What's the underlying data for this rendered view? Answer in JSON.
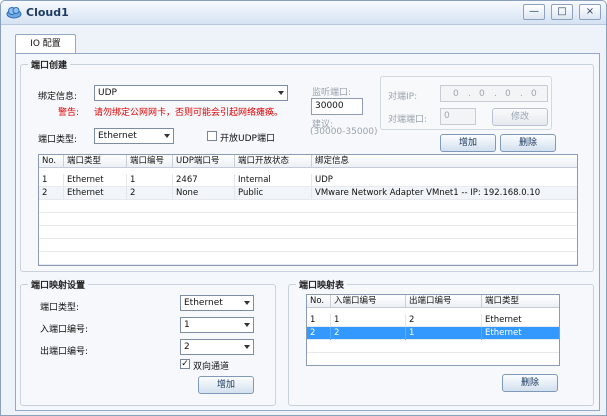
{
  "window": {
    "title": "Cloud1",
    "controls": {
      "minimize": "—",
      "maximize": "□",
      "close": "×"
    }
  },
  "tab": {
    "label": "IO 配置"
  },
  "port_create": {
    "title": "端口创建",
    "bind_label": "绑定信息:",
    "bind_value": "UDP",
    "warning_label": "警告:",
    "warning_text": "请勿绑定公网网卡，否则可能会引起网络瘫痪。",
    "type_label": "端口类型:",
    "type_value": "Ethernet",
    "open_udp_label": "开放UDP端口",
    "open_udp_checked": false,
    "listen_label": "监听端口:",
    "listen_value": "30000",
    "suggest_label": "建议:",
    "suggest_range": "(30000-35000)",
    "peer_ip_label": "对端IP:",
    "peer_ip": [
      "0",
      "0",
      "0",
      "0"
    ],
    "peer_port_label": "对端端口:",
    "peer_port_value": "0",
    "modify_button": "修改",
    "add_button": "增加",
    "delete_button": "删除"
  },
  "port_table": {
    "columns": [
      "No.",
      "端口类型",
      "端口编号",
      "UDP端口号",
      "端口开放状态",
      "绑定信息"
    ],
    "rows": [
      {
        "no": "1",
        "type": "Ethernet",
        "num": "1",
        "udp": "2467",
        "status": "Internal",
        "bind": "UDP"
      },
      {
        "no": "2",
        "type": "Ethernet",
        "num": "2",
        "udp": "None",
        "status": "Public",
        "bind": "VMware Network Adapter VMnet1 -- IP: 192.168.0.10"
      }
    ]
  },
  "mapping_settings": {
    "title": "端口映射设置",
    "type_label": "端口类型:",
    "type_value": "Ethernet",
    "in_label": "入端口编号:",
    "in_value": "1",
    "out_label": "出端口编号:",
    "out_value": "2",
    "bidirectional_label": "双向通道",
    "bidirectional_checked": true,
    "add_button": "增加"
  },
  "mapping_table": {
    "title": "端口映射表",
    "columns": [
      "No.",
      "入端口编号",
      "出端口编号",
      "端口类型"
    ],
    "rows": [
      {
        "no": "1",
        "in": "1",
        "out": "2",
        "type": "Ethernet"
      },
      {
        "no": "2",
        "in": "2",
        "out": "1",
        "type": "Ethernet"
      }
    ],
    "selected_row": 1,
    "delete_button": "删除"
  }
}
